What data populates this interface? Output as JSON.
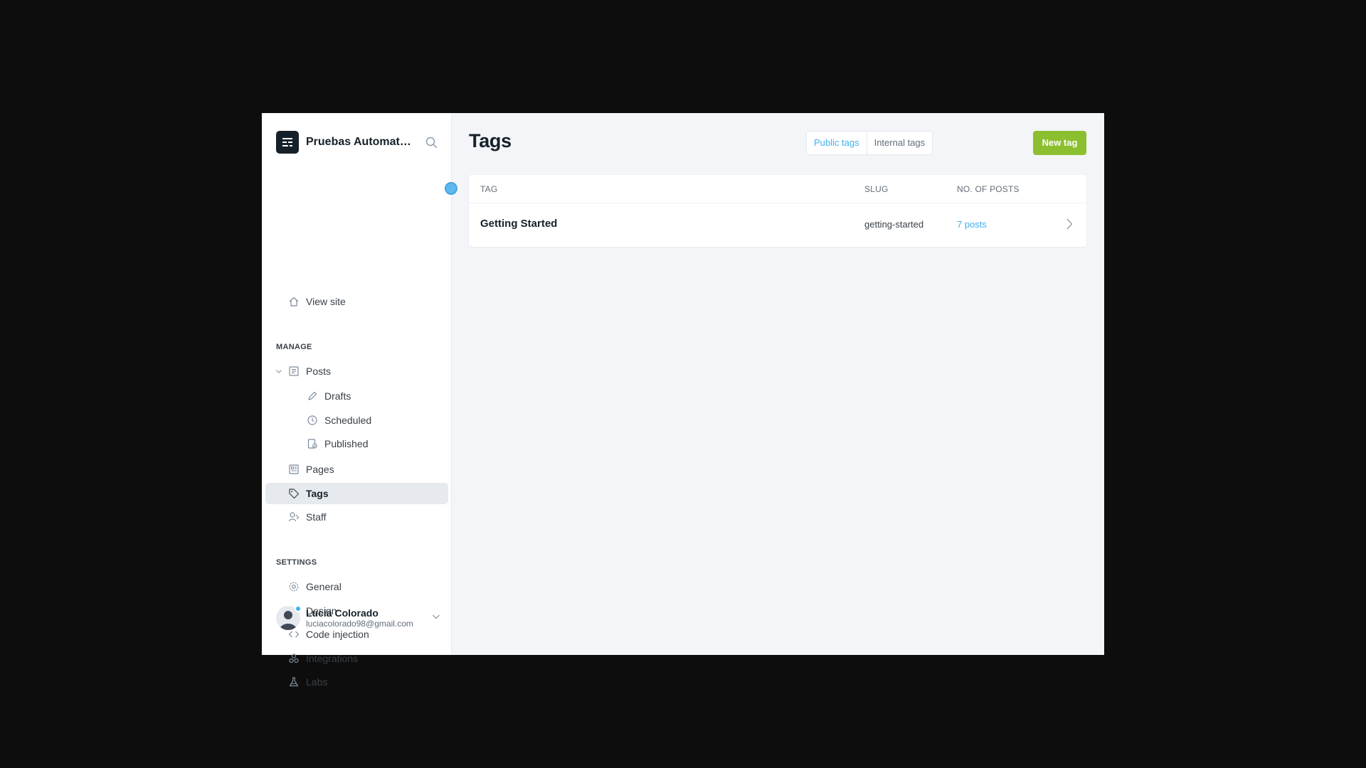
{
  "sidebar": {
    "site_name": "Pruebas Automatizadas",
    "view_site": "View site",
    "manage_label": "MANAGE",
    "posts": "Posts",
    "drafts": "Drafts",
    "scheduled": "Scheduled",
    "published": "Published",
    "pages": "Pages",
    "tags": "Tags",
    "staff": "Staff",
    "settings_label": "SETTINGS",
    "general": "General",
    "design": "Design",
    "code_injection": "Code injection",
    "integrations": "Integrations",
    "labs": "Labs"
  },
  "user": {
    "name": "Lucia Colorado",
    "email": "luciacolorado98@gmail.com"
  },
  "main": {
    "title": "Tags",
    "public_tags": "Public tags",
    "internal_tags": "Internal tags",
    "new_tag": "New tag",
    "columns": {
      "tag": "TAG",
      "slug": "SLUG",
      "posts": "NO. OF POSTS"
    },
    "rows": [
      {
        "name": "Getting Started",
        "slug": "getting-started",
        "count": "7 posts"
      }
    ]
  },
  "colors": {
    "accent": "#3eb0ef",
    "primary_button": "#8cbf2f",
    "dark": "#15212a"
  }
}
